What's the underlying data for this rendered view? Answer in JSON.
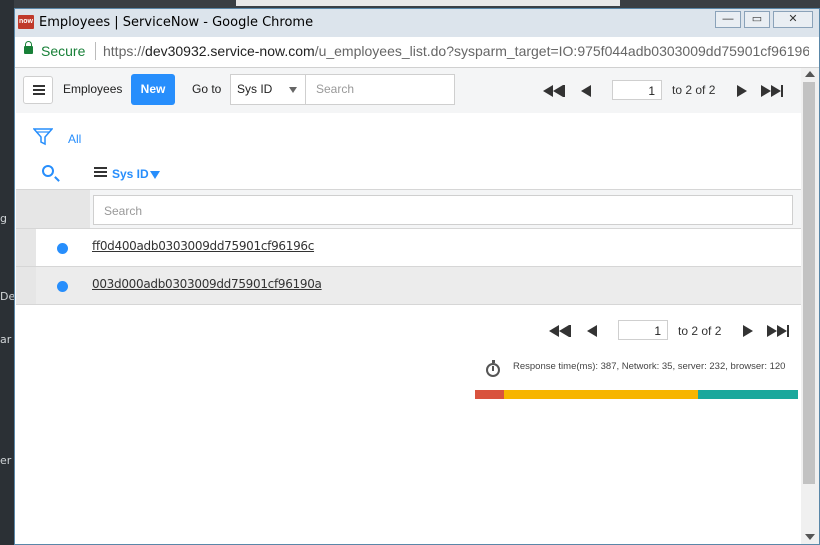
{
  "background": {
    "side_texts": [
      "g",
      "De",
      "ar",
      "er"
    ]
  },
  "window": {
    "title": "Employees | ServiceNow - Google Chrome",
    "favicon_text": "now",
    "controls": {
      "minimize": "—",
      "maximize": "▭",
      "close": "✕"
    }
  },
  "address": {
    "secure_label": "Secure",
    "url_scheme": "https://",
    "url_host": "dev30932.service-now.com",
    "url_path": "/u_employees_list.do?sysparm_target=IO:975f044adb0303009dd75901cf96196..."
  },
  "header": {
    "title": "Employees",
    "new_label": "New",
    "goto_label": "Go to",
    "field_select": "Sys ID",
    "search_placeholder": "Search",
    "page_value": "1",
    "page_label": "to 2 of 2"
  },
  "filter": {
    "all_label": "All"
  },
  "columns": {
    "sys_id_label": "Sys ID",
    "search_placeholder": "Search"
  },
  "rows": [
    {
      "sys_id": "ff0d400adb0303009dd75901cf96196c"
    },
    {
      "sys_id": "003d000adb0303009dd75901cf96190a"
    }
  ],
  "footer": {
    "page_value": "1",
    "page_label": "to 2 of 2",
    "response_text": "Response time(ms): 387, Network: 35, server: 232, browser: 120",
    "perf": {
      "network_ms": 35,
      "server_ms": 232,
      "browser_ms": 120,
      "colors": {
        "network": "#d9533e",
        "server": "#f7b500",
        "browser": "#1aa89c"
      }
    }
  },
  "colors": {
    "accent": "#278efc",
    "secure": "#188038"
  }
}
